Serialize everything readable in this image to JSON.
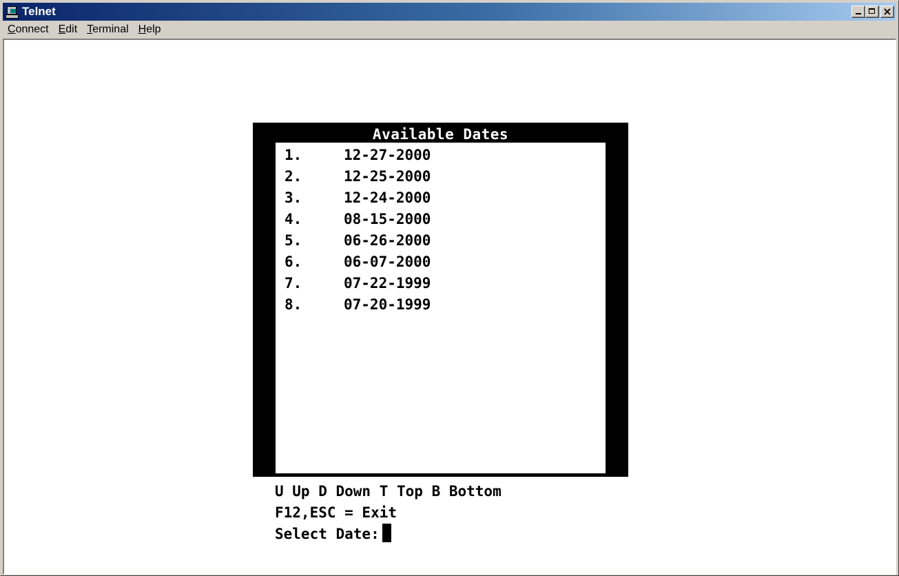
{
  "window": {
    "title": "Telnet",
    "title_buttons": {
      "minimize": "minimize",
      "maximize": "maximize",
      "close": "×"
    }
  },
  "menu": [
    {
      "accel": "C",
      "rest": "onnect"
    },
    {
      "accel": "E",
      "rest": "dit"
    },
    {
      "accel": "T",
      "rest": "erminal"
    },
    {
      "accel": "H",
      "rest": "elp"
    }
  ],
  "terminal": {
    "box_title": "Available Dates",
    "dates": [
      {
        "num": "1.",
        "date": "12-27-2000"
      },
      {
        "num": "2.",
        "date": "12-25-2000"
      },
      {
        "num": "3.",
        "date": "12-24-2000"
      },
      {
        "num": "4.",
        "date": "08-15-2000"
      },
      {
        "num": "5.",
        "date": "06-26-2000"
      },
      {
        "num": "6.",
        "date": "06-07-2000"
      },
      {
        "num": "7.",
        "date": "07-22-1999"
      },
      {
        "num": "8.",
        "date": "07-20-1999"
      }
    ],
    "help_line": "U Up D Down T Top B Bottom",
    "exit_line": "F12,ESC = Exit",
    "prompt": "Select Date:"
  },
  "colors": {
    "titlebar_start": "#0a246a",
    "titlebar_end": "#a6caf0",
    "terminal_bg": "#ffffff",
    "terminal_fg": "#000000",
    "box_bg": "#000000"
  }
}
